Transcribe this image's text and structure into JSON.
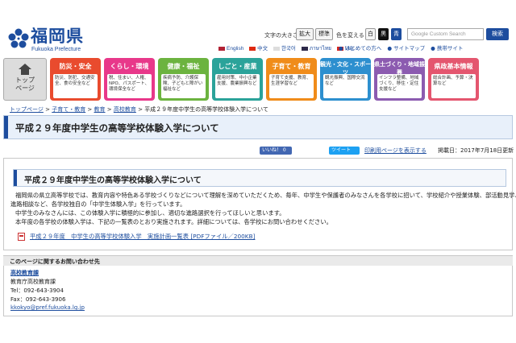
{
  "header": {
    "logo_name": "福岡県",
    "logo_en": "Fukuoka Prefecture",
    "font_size_label": "文字の大きさ",
    "font_large": "拡大",
    "font_standard": "標準",
    "color_label": "色を変える",
    "color_white": "白",
    "color_black": "黒",
    "color_blue": "青",
    "search_placeholder": "Google Custom Search",
    "search_button": "検索",
    "brand_color": "#1d4d9e"
  },
  "languages": [
    {
      "label": "English",
      "flag_color": "#b22234"
    },
    {
      "label": "中文",
      "flag_color": "#de2910"
    },
    {
      "label": "한국어",
      "flag_color": "#003478"
    },
    {
      "label": "ภาษาไทย",
      "flag_color": "#2d2a4a"
    },
    {
      "label": "Việt",
      "flag_color": "#da251d"
    }
  ],
  "utility_links": [
    "● はじめての方へ",
    "● サイトマップ",
    "● 携帯サイト"
  ],
  "nav": {
    "home_label_1": "トップ",
    "home_label_2": "ページ",
    "categories": [
      {
        "title": "防災・安全",
        "color": "#e94b2e",
        "body": "防災、防犯、交通安全、食の安全など"
      },
      {
        "title": "くらし・環境",
        "color": "#e8388a",
        "body": "税、住まい、人権、NPO、パスポート、環境保全など"
      },
      {
        "title": "健康・福祉",
        "color": "#6cb33f",
        "body": "疾病予防、介護保険、子どもと障がい福祉など"
      },
      {
        "title": "しごと・産業",
        "color": "#2ba39a",
        "body": "雇用対策、中小企業支援、農業振興など"
      },
      {
        "title": "子育て・教育",
        "color": "#f08c1a",
        "body": "子育て支援、教育、生涯学習など"
      },
      {
        "title": "観光・文化・スポーツ",
        "color": "#2d8fcf",
        "body": "観光振興、国際交流など"
      },
      {
        "title": "県土づくり・地域振興",
        "color": "#8c5bb0",
        "body": "インフラ整備、地域づくり、移住・定住支援など"
      },
      {
        "title": "県政基本情報",
        "color": "#e4566f",
        "body": "総合計画、予算・決算など"
      }
    ]
  },
  "breadcrumb": {
    "items": [
      "トップページ",
      "子育て・教育",
      "教育",
      "高校教育"
    ],
    "separator": " > ",
    "current": "平成２９年度中学生の高等学校体験入学について"
  },
  "page": {
    "title": "平成２９年度中学生の高等学校体験入学について",
    "like": "いいね！ 0",
    "tweet": "ツイート",
    "print": "印刷用ページを表示する",
    "posted": "掲載日：2017年7月18日更新",
    "heading": "平成２９年度中学生の高等学校体験入学について",
    "paragraphs": [
      "福岡県の県立高等学校では、教育内容や特色ある学校づくりなどについて理解を深めていただくため、毎年、中学生や保護者のみなさんを各学校に招いて、学校紹介や授業体験、部活動見学、",
      "進路相談など、各学校独自の「中学生体験入学」を行っています。",
      "中学生のみなさんには、この体験入学に積極的に参加し、適切な進路選択を行ってほしいと思います。",
      "本年度の各学校の体験入学は、下記の一覧表のとおり実施されます。詳細については、各学校にお問い合わせください。"
    ],
    "pdf_link": "平成２９年度　中学生の高等学校体験入学　実施計画一覧表 [PDFファイル／200KB]"
  },
  "contact": {
    "heading": "このページに関するお問い合わせ先",
    "dept": "高校教育課",
    "org": "教育庁高校教育課",
    "tel": "Tel：092-643-3904",
    "fax": "Fax：092-643-3906",
    "email": "kkokyo@pref.fukuoka.lg.jp"
  }
}
